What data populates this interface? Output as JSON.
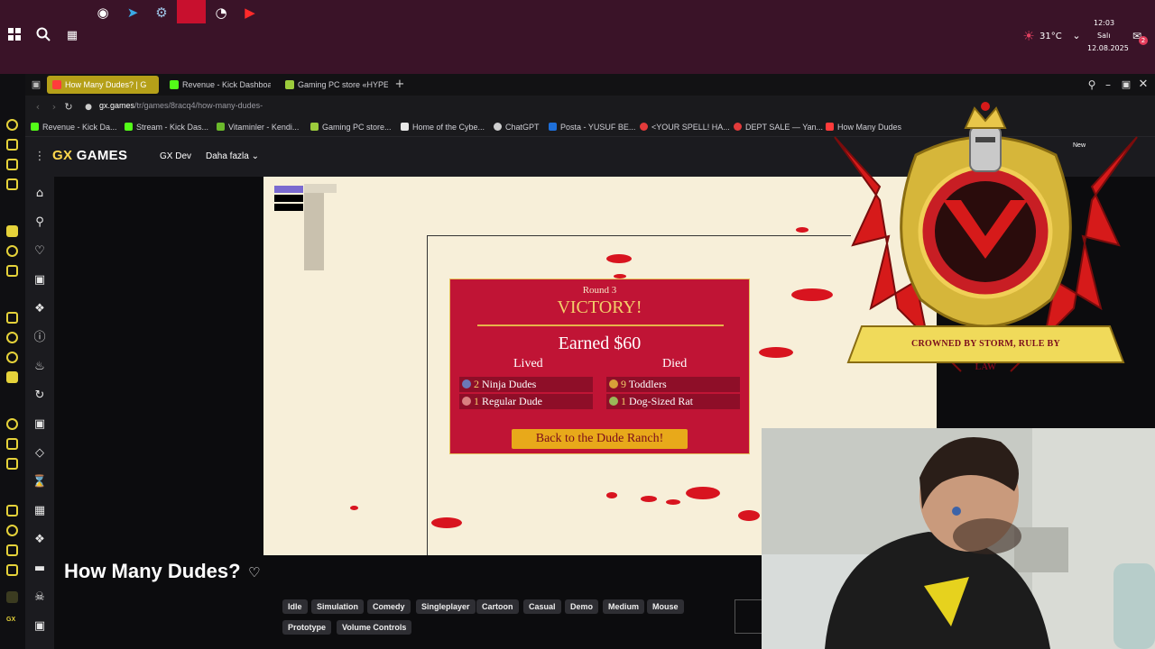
{
  "taskbar": {
    "temperature": "31°C",
    "time": "12:03",
    "day": "Salı",
    "date": "12.08.2025",
    "notif_count": "2"
  },
  "tabs": [
    {
      "label": "How Many Dudes? | G",
      "active": true,
      "color": "#ff3b3b"
    },
    {
      "label": "Revenue - Kick Dashboar",
      "active": false,
      "color": "#53fc18"
    },
    {
      "label": "Gaming PC store «HYPER",
      "active": false,
      "color": "#9ccc3c"
    }
  ],
  "url": {
    "host": "gx.games",
    "path": "/tr/games/8racq4/how-many-dudes-"
  },
  "bookmarks": [
    {
      "label": "Revenue - Kick Da...",
      "color": "#53fc18"
    },
    {
      "label": "Stream - Kick Das...",
      "color": "#53fc18"
    },
    {
      "label": "Vitaminler - Kendi...",
      "color": "#6bb92b"
    },
    {
      "label": "Gaming PC store...",
      "color": "#9ccc3c"
    },
    {
      "label": "Home of the Cybe...",
      "color": "#e8e8e8"
    },
    {
      "label": "ChatGPT",
      "color": "#cfcfcf"
    },
    {
      "label": "Posta - YUSUF BE...",
      "color": "#1e6fd9"
    },
    {
      "label": "<YOUR SPELL! HA...",
      "color": "#e23b3b"
    },
    {
      "label": "DEPT SALE — Yan...",
      "color": "#e23b3b"
    },
    {
      "label": "How Many Dudes",
      "color": "#ff3b3b"
    }
  ],
  "gx": {
    "logo_gx": "GX",
    "logo_games": "GAMES",
    "nav_dev": "GX Dev",
    "nav_more": "Daha fazla",
    "new_badge": "New"
  },
  "card": {
    "round": "Round 3",
    "victory": "VICTORY!",
    "earned": "Earned $60",
    "lived_header": "Lived",
    "died_header": "Died",
    "lived": [
      {
        "count": "2",
        "name": "Ninja Dudes"
      },
      {
        "count": "1",
        "name": "Regular Dude"
      }
    ],
    "died": [
      {
        "count": "9",
        "name": "Toddlers"
      },
      {
        "count": "1",
        "name": "Dog-Sized Rat"
      }
    ],
    "button": "Back to the Dude Ranch!"
  },
  "game_title": "How Many Dudes?",
  "tags": [
    "Idle",
    "Simulation",
    "Comedy",
    "Singleplayer",
    "Cartoon",
    "Casual",
    "Demo",
    "Medium",
    "Mouse",
    "Prototype",
    "Volume Controls"
  ],
  "emblem": {
    "motto": "CROWNED BY STORM, RULE BY LAW"
  }
}
